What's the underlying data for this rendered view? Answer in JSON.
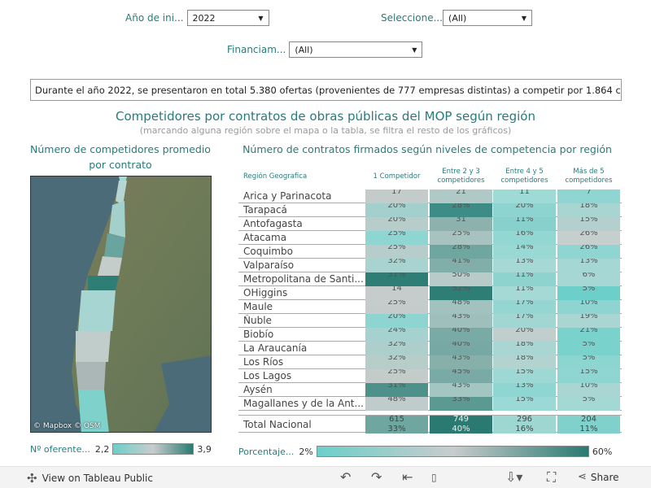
{
  "filters": {
    "year_label": "Año de ini...",
    "year_value": "2022",
    "select_label": "Seleccione...",
    "select_value": "(All)",
    "financing_label": "Financiam...",
    "financing_value": "(All)"
  },
  "summary": "Durante el año 2022, se presentaron en total 5.380 ofertas (provenientes de 777 empresas distintas) a competir por 1.864 con...",
  "main_title": "Competidores por contratos de obras públicas del MOP según región",
  "main_subtitle": "(marcando alguna región sobre el mapa o la tabla, se filtra el resto de los gráficos)",
  "left_title": "Número de competidores promedio por contrato",
  "map_attribution": "© Mapbox  © OSM",
  "right_title": "Número de contratos firmados según niveles de competencia por región",
  "table": {
    "region_header": "Región Geografica",
    "columns": [
      "1 Competidor",
      "Entre 2 y 3 competidores",
      "Entre 4 y 5 competidores",
      "Más de 5 competidores"
    ],
    "rows": [
      {
        "name": "Arica y Parinacota",
        "values": [
          "17",
          "21",
          "11",
          "7"
        ],
        "colors": [
          "#c4cccb",
          "#b0c8c6",
          "#9edad6",
          "#8fd6d2"
        ]
      },
      {
        "name": "Tarapacá",
        "values": [
          "20%",
          "28%",
          "20%",
          "18%"
        ],
        "colors": [
          "#a3d0cc",
          "#3d8c86",
          "#8dd3cf",
          "#a8d4d1"
        ]
      },
      {
        "name": "Antofagasta",
        "values": [
          "20%",
          "31",
          "11%",
          "15%"
        ],
        "colors": [
          "#b6cdca",
          "#8db1ad",
          "#88d0cc",
          "#b3d0ce"
        ]
      },
      {
        "name": "Atacama",
        "values": [
          "25%",
          "25%",
          "16%",
          "26%"
        ],
        "colors": [
          "#8fd5d1",
          "#a7c3c0",
          "#93d7d3",
          "#c5cfce"
        ]
      },
      {
        "name": "Coquimbo",
        "values": [
          "25%",
          "28%",
          "14%",
          "26%"
        ],
        "colors": [
          "#b7cdcb",
          "#6fa6a0",
          "#9ad8d4",
          "#8fd6d2"
        ]
      },
      {
        "name": "Valparaíso",
        "values": [
          "32%",
          "41%",
          "13%",
          "13%"
        ],
        "colors": [
          "#a8d3d0",
          "#82aea9",
          "#a6d9d6",
          "#a5d7d4"
        ]
      },
      {
        "name": "Metropolitana de Santi...",
        "values": [
          "31%",
          "50%",
          "11%",
          "6%"
        ],
        "colors": [
          "#2e7e76",
          "#b8cbc9",
          "#8fd3cf",
          "#a7d7d4"
        ]
      },
      {
        "name": "OHiggins",
        "values": [
          "14",
          "52%",
          "11%",
          "5%"
        ],
        "colors": [
          "#c6cccb",
          "#2e7e76",
          "#a5d9d5",
          "#6ccfca"
        ]
      },
      {
        "name": "Maule",
        "values": [
          "25%",
          "48%",
          "17%",
          "10%"
        ],
        "colors": [
          "#c3ccca",
          "#a1c2bf",
          "#95d6d2",
          "#8ed5d1"
        ]
      },
      {
        "name": "Ñuble",
        "values": [
          "20%",
          "43%",
          "17%",
          "19%"
        ],
        "colors": [
          "#8ed5d1",
          "#9ebfbc",
          "#a1d6d3",
          "#a9d5d2"
        ]
      },
      {
        "name": "Biobío",
        "values": [
          "24%",
          "40%",
          "20%",
          "21%"
        ],
        "colors": [
          "#a5d2cf",
          "#7aaaa5",
          "#c1cecd",
          "#7ad2cd"
        ]
      },
      {
        "name": "La Araucanía",
        "values": [
          "32%",
          "40%",
          "18%",
          "5%"
        ],
        "colors": [
          "#adcfcc",
          "#78a8a3",
          "#a9d6d3",
          "#7ad2cd"
        ]
      },
      {
        "name": "Los Ríos",
        "values": [
          "32%",
          "43%",
          "18%",
          "5%"
        ],
        "colors": [
          "#b6cdca",
          "#88b0ab",
          "#b3d3d0",
          "#8dd5d1"
        ]
      },
      {
        "name": "Los Lagos",
        "values": [
          "25%",
          "45%",
          "15%",
          "15%"
        ],
        "colors": [
          "#c4ccca",
          "#7aaaa5",
          "#9ed8d4",
          "#8fd6d2"
        ]
      },
      {
        "name": "Aysén",
        "values": [
          "31%",
          "43%",
          "13%",
          "10%"
        ],
        "colors": [
          "#4e918a",
          "#a4c6c3",
          "#8fd5d1",
          "#a9d6d3"
        ]
      },
      {
        "name": "Magallanes y de la Ant...",
        "values": [
          "48%",
          "33%",
          "15%",
          "5%"
        ],
        "colors": [
          "#bfcccb",
          "#5a9a93",
          "#9ad9d5",
          "#a4d8d4"
        ]
      }
    ],
    "total": {
      "name": "Total Nacional",
      "values": [
        "615",
        "749",
        "296",
        "204"
      ],
      "colors": [
        "#6fa6a0",
        "#2a7a72",
        "#9ed6d2",
        "#80d0cb"
      ]
    },
    "total_pct": [
      "33%",
      "40%",
      "16%",
      "11%"
    ]
  },
  "legend_left": {
    "label": "Nº oferente...",
    "min": "2,2",
    "max": "3,9"
  },
  "legend_right": {
    "label": "Porcentaje...",
    "min": "2%",
    "max": "60%"
  },
  "footer": {
    "view_label": "View on Tableau Public",
    "share_label": "Share"
  },
  "colors": {
    "accent": "#2a7a7a",
    "dark_teal": "#2a7a72",
    "light_teal": "#6ccfca",
    "neutral": "#c8cccc"
  }
}
